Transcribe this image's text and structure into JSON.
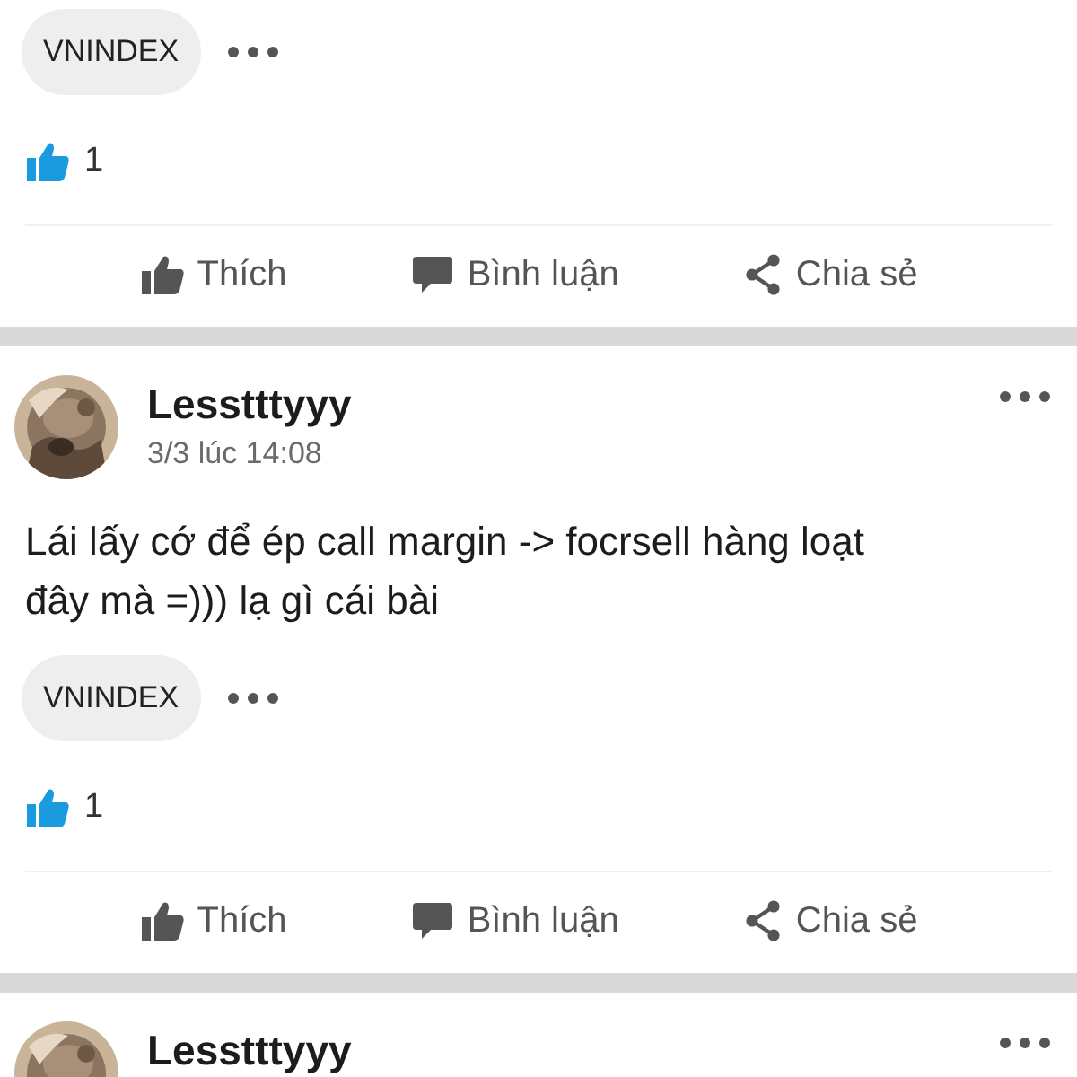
{
  "posts": [
    {
      "tags": [
        "VNINDEX"
      ],
      "like_count": "1",
      "actions": [
        {
          "kind": "like",
          "label": "Thích"
        },
        {
          "kind": "comment",
          "label": "Bình luận"
        },
        {
          "kind": "share",
          "label": "Chia sẻ"
        }
      ]
    },
    {
      "author": "Lesstttyyy",
      "time": "3/3 lúc 14:08",
      "text": "Lái lấy cớ để ép call margin -> focrsell hàng loạt đây mà =))) lạ gì cái bài",
      "tags": [
        "VNINDEX"
      ],
      "like_count": "1",
      "actions": [
        {
          "kind": "like",
          "label": "Thích"
        },
        {
          "kind": "comment",
          "label": "Bình luận"
        },
        {
          "kind": "share",
          "label": "Chia sẻ"
        }
      ]
    },
    {
      "author": "Lesstttyyy"
    }
  ]
}
